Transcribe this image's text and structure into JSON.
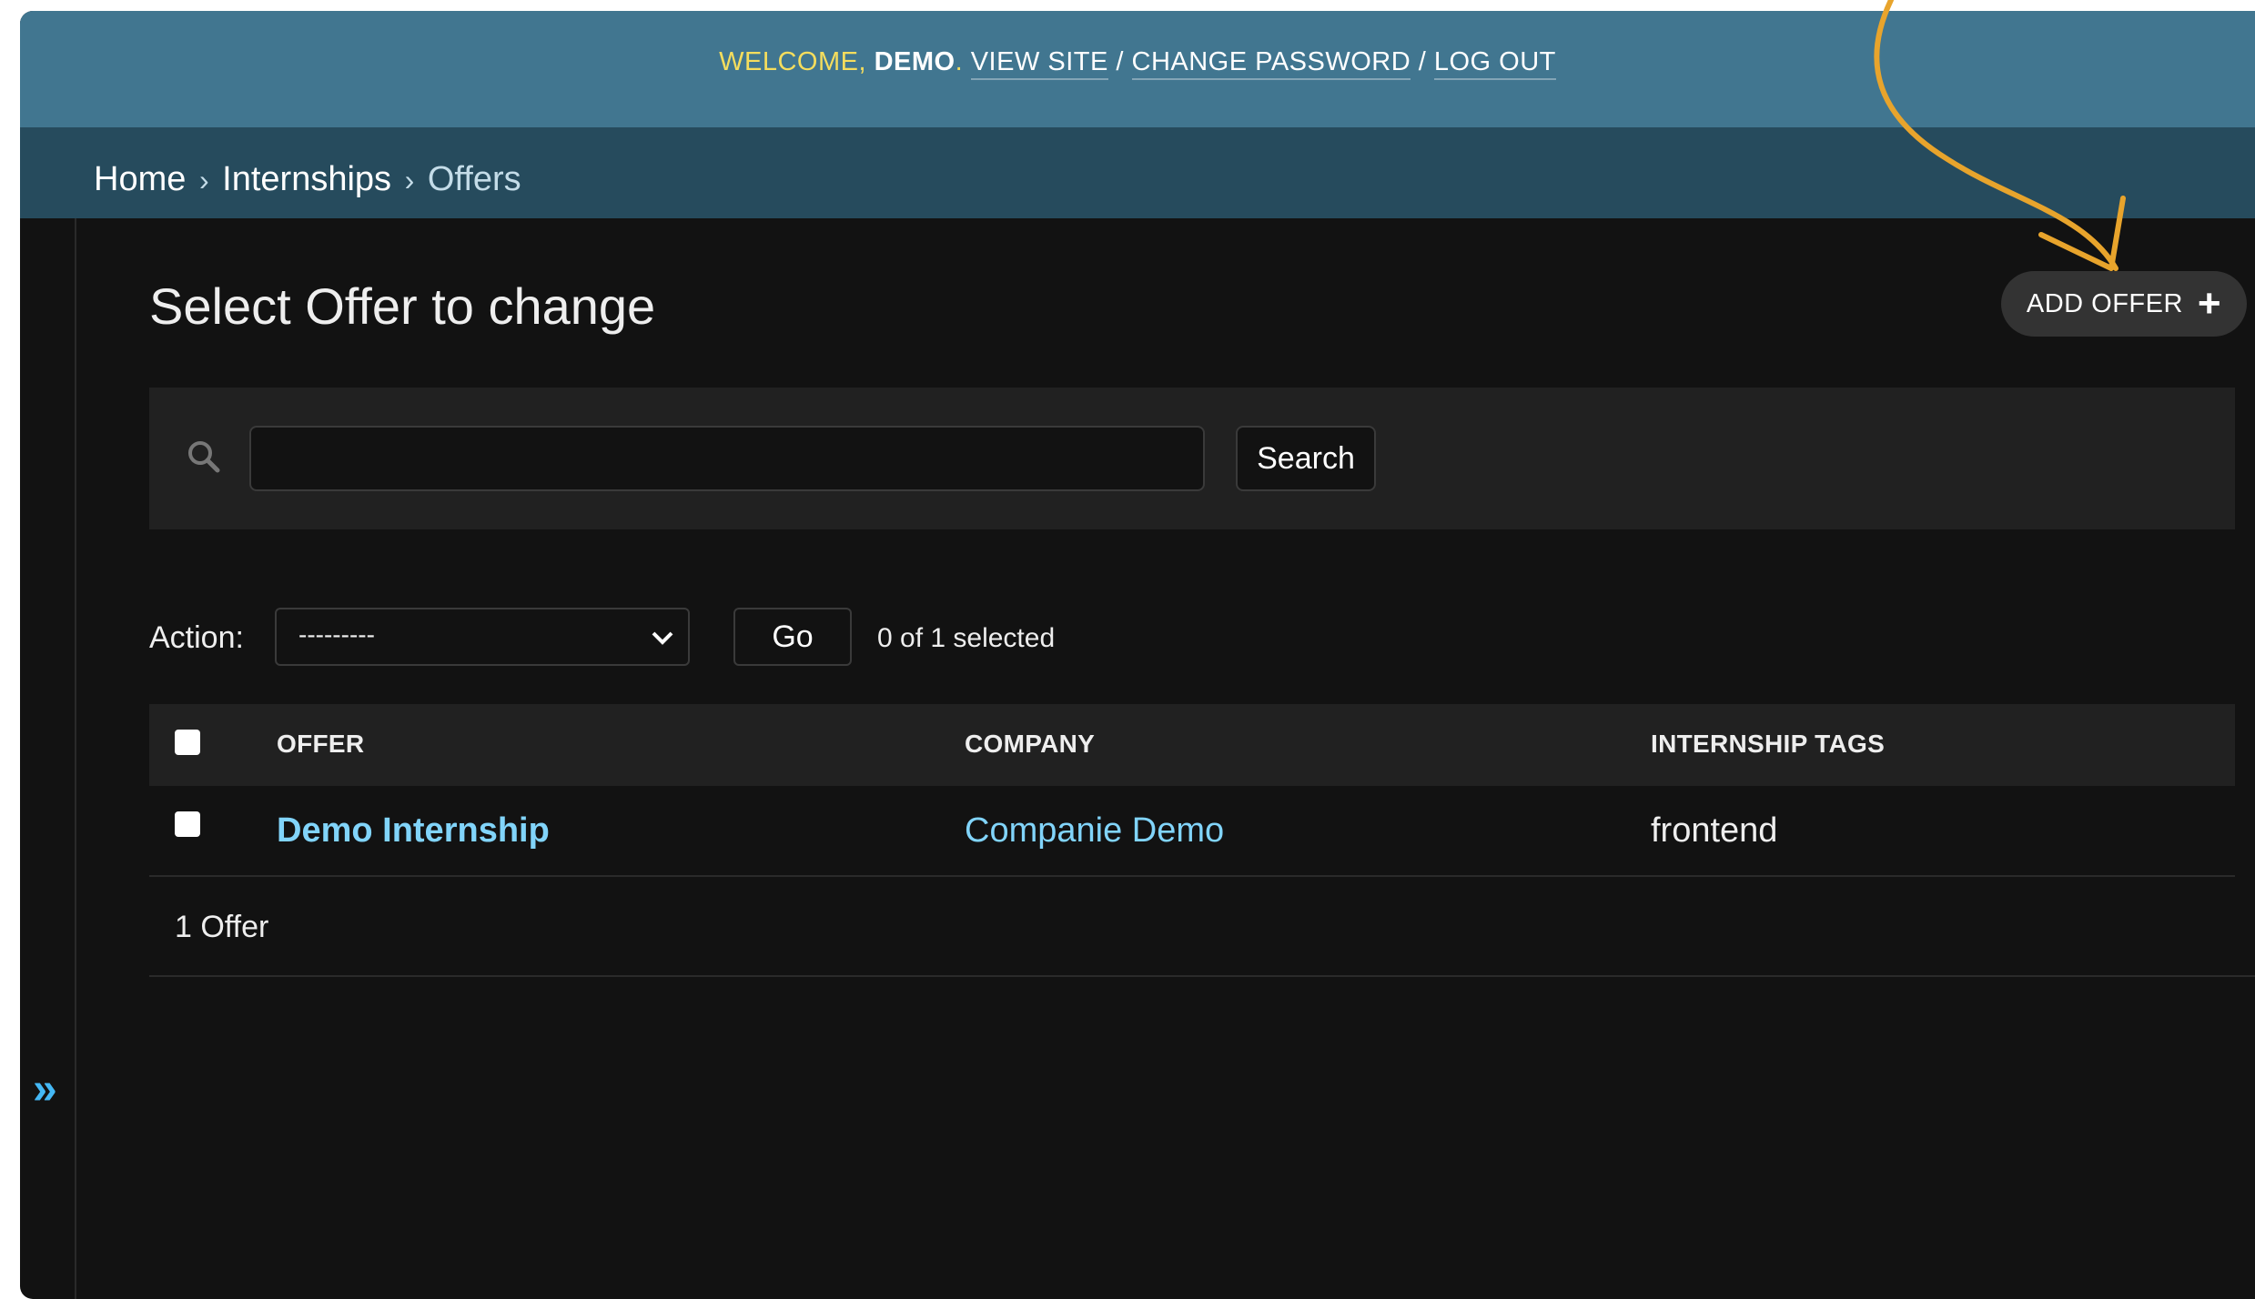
{
  "header": {
    "welcome_prefix": "WELCOME, ",
    "username": "DEMO",
    "dot": ". ",
    "view_site": "VIEW SITE",
    "sep1": " / ",
    "change_password": "CHANGE PASSWORD",
    "sep2": " / ",
    "log_out": "LOG OUT"
  },
  "breadcrumbs": [
    {
      "label": "Home"
    },
    {
      "label": "Internships"
    },
    {
      "label": "Offers"
    }
  ],
  "breadcrumb_separator": "›",
  "sidebar": {
    "toggle_label": "»"
  },
  "main": {
    "title": "Select Offer to change",
    "add_button": "ADD OFFER",
    "search": {
      "value": "",
      "button": "Search"
    },
    "action": {
      "label": "Action:",
      "selected_value": "---------",
      "go": "Go",
      "selected_count": "0 of 1 selected"
    },
    "table": {
      "columns": [
        "OFFER",
        "COMPANY",
        "INTERNSHIP TAGS"
      ],
      "rows": [
        {
          "offer": "Demo Internship",
          "company": "Companie Demo",
          "tags": "frontend"
        }
      ]
    },
    "paginator": "1 Offer"
  },
  "colors": {
    "header_bg": "#417690",
    "breadcrumb_bg": "#264b5d",
    "page_bg": "#121212",
    "link": "#81d4fa",
    "accent_yellow": "#f5dd5d",
    "annotation_arrow": "#e8a42c"
  }
}
